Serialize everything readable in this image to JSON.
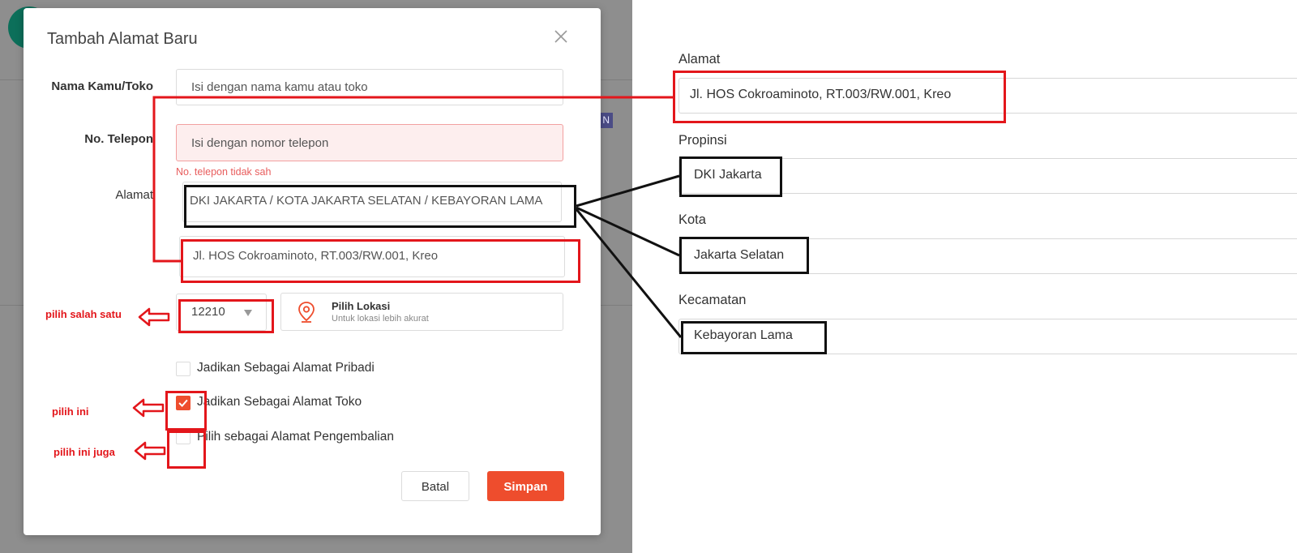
{
  "modal": {
    "title": "Tambah Alamat Baru",
    "name_label": "Nama Kamu/Toko",
    "name_placeholder": "Isi dengan nama kamu atau toko",
    "phone_label": "No. Telepon",
    "phone_placeholder": "Isi dengan nomor telepon",
    "phone_error": "No. telepon tidak sah",
    "address_label": "Alamat",
    "region_value": "DKI JAKARTA / KOTA JAKARTA SELATAN / KEBAYORAN LAMA",
    "street_value": "Jl. HOS Cokroaminoto, RT.003/RW.001, Kreo",
    "postal_value": "12210",
    "location_title": "Pilih Lokasi",
    "location_subtitle": "Untuk lokasi lebih akurat",
    "checkboxes": [
      {
        "label": "Jadikan Sebagai Alamat Pribadi",
        "checked": false
      },
      {
        "label": "Jadikan Sebagai Alamat Toko",
        "checked": true
      },
      {
        "label": "Pilih sebagai Alamat Pengembalian",
        "checked": false
      }
    ],
    "cancel_label": "Batal",
    "save_label": "Simpan"
  },
  "annotations": {
    "pick_one": "pilih salah satu",
    "pick_this": "pilih ini",
    "pick_this_too": "pilih ini juga"
  },
  "right_panel": {
    "alamat_label": "Alamat",
    "alamat_value": "Jl. HOS Cokroaminoto, RT.003/RW.001, Kreo",
    "propinsi_label": "Propinsi",
    "propinsi_value": "DKI Jakarta",
    "kota_label": "Kota",
    "kota_value": "Jakarta Selatan",
    "kecamatan_label": "Kecamatan",
    "kecamatan_value": "Kebayoran Lama"
  },
  "colors": {
    "accent": "#ee4d2d",
    "annotation_red": "#e3161b",
    "annotation_black": "#111111",
    "error": "#e85c5c"
  },
  "icons": [
    "close-icon",
    "caret-down-icon",
    "location-pin-icon",
    "check-icon",
    "arrow-left-icon"
  ]
}
